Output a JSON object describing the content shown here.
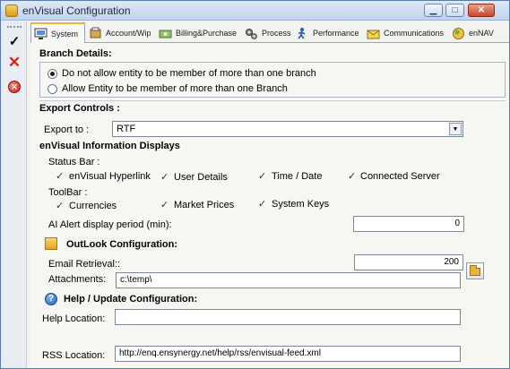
{
  "window": {
    "title": "enVisual Configuration"
  },
  "window_controls": {
    "minimize": "▁",
    "maximize": "□",
    "close": "✕"
  },
  "left_toolbar": {
    "confirm_icon": "check-icon",
    "cancel_icon": "close-icon",
    "stop_icon": "stop-icon",
    "confirm_glyph": "✓",
    "cancel_glyph": "✕",
    "stop_glyph": "✕"
  },
  "tabs": [
    {
      "label": "System",
      "icon": "system-icon",
      "active": true
    },
    {
      "label": "Account/Wip",
      "icon": "account-icon"
    },
    {
      "label": "Billing&Purchase",
      "icon": "billing-icon"
    },
    {
      "label": "Process",
      "icon": "gears-icon"
    },
    {
      "label": "Performance",
      "icon": "performance-icon"
    },
    {
      "label": "Communications",
      "icon": "communications-icon"
    },
    {
      "label": "enNAV",
      "icon": "ennav-icon"
    }
  ],
  "branch": {
    "heading": "Branch  Details:",
    "options": [
      {
        "label": "Do not allow entity to be member of more than one branch",
        "selected": true
      },
      {
        "label": "Allow Entity to be member of more than one Branch",
        "selected": false
      }
    ]
  },
  "export": {
    "heading": "Export Controls :",
    "label": "Export to :",
    "value": "RTF"
  },
  "displays": {
    "heading": "enVisual Information Displays",
    "status_bar_label": "Status Bar :",
    "status_bar_items": [
      {
        "label": "enVisual Hyperlink",
        "checked": true
      },
      {
        "label": "User Details",
        "checked": true
      },
      {
        "label": "Time / Date",
        "checked": true
      },
      {
        "label": "Connected Server",
        "checked": true
      }
    ],
    "toolbar_label": "ToolBar :",
    "toolbar_items": [
      {
        "label": "Currencies",
        "checked": true
      },
      {
        "label": "Market Prices",
        "checked": true
      },
      {
        "label": "System Keys",
        "checked": true
      }
    ],
    "alert_label": "AI Alert display period  (min):",
    "alert_value": "0"
  },
  "outlook": {
    "heading": "OutLook Configuration:",
    "email_label": "Email Retrieval::",
    "email_value": "200",
    "attachments_label": "Attachments:",
    "attachments_value": "c:\\temp\\"
  },
  "help": {
    "heading": "Help / Update Configuration:",
    "help_location_label": "Help Location:",
    "help_location_value": "",
    "rss_label": "RSS Location:",
    "rss_value": "http://enq.ensynergy.net/help/rss/envisual-feed.xml"
  },
  "glyphs": {
    "check": "✓",
    "dropdown": "▼",
    "help": "?"
  },
  "colors": {
    "accent_tab": "#f0b33a",
    "title_bar": "#c1d3ec",
    "panel": "#f6f6f3"
  }
}
